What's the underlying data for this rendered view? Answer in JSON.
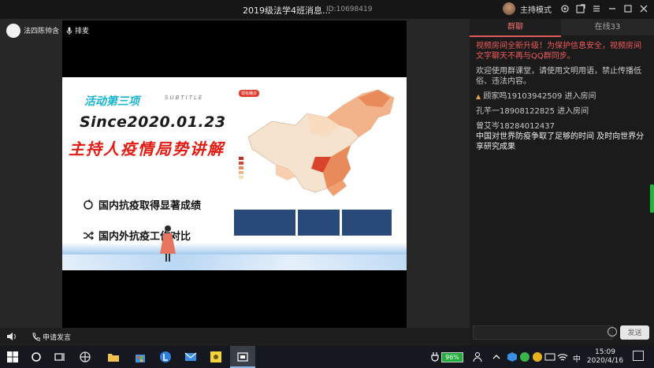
{
  "window": {
    "title": "2019级法学4班消息...",
    "room_id": "ID:10698419",
    "mode_label": "主持模式"
  },
  "stage": {
    "host_name": "法四陈帅含",
    "queue_label": "排麦"
  },
  "slide": {
    "activity": "活动第三项",
    "subtitle": "SUBTITLE",
    "since": "Since2020.01.23",
    "headline": "主持人疫情局势讲解",
    "bullet1": "国内抗疫取得显著成绩",
    "bullet2": "国内外抗疫工作对比",
    "map_tag": "现有确诊"
  },
  "controls": {
    "request_speak": "申请发言"
  },
  "panel": {
    "tabs": [
      {
        "label": "群聊"
      },
      {
        "label": "在线33"
      }
    ],
    "messages": [
      {
        "text": "视频房间全新升级！为保护信息安全，视频房间文字聊天不再与QQ群同步。"
      },
      {
        "text": "欢迎使用群课堂，请使用文明用语，禁止传播低俗、违法内容。"
      },
      {
        "text": "顾家鸣19103942509 进入房间"
      },
      {
        "text": "孔芊一18908122825 进入房间"
      },
      {
        "text": "曾艾岑18284012437"
      },
      {
        "text": "中国对世界防疫争取了足够的时间 及时向世界分享研究成果"
      }
    ],
    "send_label": "发送"
  },
  "taskbar": {
    "battery": "96%",
    "ime": "中",
    "time": "15:09",
    "date": "2020/4/16"
  },
  "colors": {
    "accent_red": "#e25a5a",
    "system_red": "#f05a5a",
    "battery_green": "#1fae3a"
  }
}
